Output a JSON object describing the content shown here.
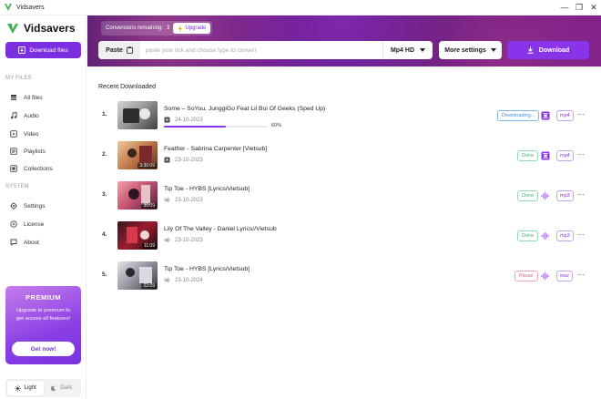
{
  "window": {
    "app_name": "Vidsavers",
    "minimize": "—",
    "maximize": "❐",
    "close": "✕"
  },
  "sidebar": {
    "brand": "Vidsavers",
    "download_files_label": "Download files",
    "my_files_title": "MY FILES",
    "my_files": [
      {
        "label": "All files",
        "icon": "stack-icon"
      },
      {
        "label": "Audio",
        "icon": "music-note-icon"
      },
      {
        "label": "Video",
        "icon": "video-icon"
      },
      {
        "label": "Playlists",
        "icon": "playlist-icon"
      },
      {
        "label": "Collections",
        "icon": "collection-icon"
      }
    ],
    "system_title": "SYSTEM",
    "system": [
      {
        "label": "Settings",
        "icon": "gear-icon"
      },
      {
        "label": "License",
        "icon": "key-icon"
      },
      {
        "label": "About",
        "icon": "info-icon"
      }
    ],
    "premium": {
      "title": "PREMIUM",
      "description": "Upgrade to premium to get access all features!",
      "cta": "Get now!"
    },
    "theme": {
      "light": "Light",
      "dark": "Dark",
      "selected": "Light"
    }
  },
  "header": {
    "conversions_label": "Conversions remaining:",
    "conversions_value": "3",
    "upgrade_label": "Upgrade",
    "paste_label": "Paste",
    "url_placeholder": "paste your link and choose type to convert",
    "format_value": "Mp4 HD",
    "more_settings_label": "More settings",
    "download_label": "Download"
  },
  "content": {
    "title": "Recent Downloaded",
    "rows": [
      {
        "num": "1.",
        "title": "Some – SoYou, JunggiGo Feat Lil Boi Of Geeks (Sped Up)",
        "date": "24-10-2023",
        "kind": "video",
        "duration": "",
        "status": "Downloading...",
        "status_type": "downloading",
        "format": "mp4",
        "progress": 60,
        "progress_text": "60%",
        "thumb_colors": [
          "#c9c9c9",
          "#6b6b6b"
        ]
      },
      {
        "num": "2.",
        "title": "Feather - Sabrina Carpenter [Vietsub]",
        "date": "23-10-2023",
        "kind": "video",
        "duration": "3:30:09",
        "status": "Done",
        "status_type": "done",
        "format": "mp4",
        "thumb_colors": [
          "#d8a070",
          "#7a4a2c"
        ]
      },
      {
        "num": "3.",
        "title": "Tip Toe - HYBS [Lyrics/Vietsub]",
        "date": "23-10-2023",
        "kind": "audio",
        "duration": "30:09",
        "status": "Done",
        "status_type": "done",
        "format": "mp3",
        "thumb_colors": [
          "#e37a8a",
          "#5c2a4a"
        ]
      },
      {
        "num": "4.",
        "title": "Lily Of The Valley - Daniel Lyrics//Vietsub",
        "date": "23-10-2023",
        "kind": "audio",
        "duration": "11:09",
        "status": "Done",
        "status_type": "done",
        "format": "mp3",
        "thumb_colors": [
          "#c0283a",
          "#2a1018"
        ]
      },
      {
        "num": "5.",
        "title": "Tip Toe - HYBS [Lyrics/Vietsub]",
        "date": "23-10-2024",
        "kind": "audio",
        "duration": "22:09",
        "status": "Pause",
        "status_type": "pause",
        "format": "wav",
        "thumb_colors": [
          "#b9b9c2",
          "#4a4a55"
        ]
      }
    ],
    "more_symbol": "⋯"
  },
  "colors": {
    "accent": "#8a34ea",
    "done": "#3db36b",
    "downloading": "#3a8fd8",
    "pause": "#e05c7a"
  }
}
